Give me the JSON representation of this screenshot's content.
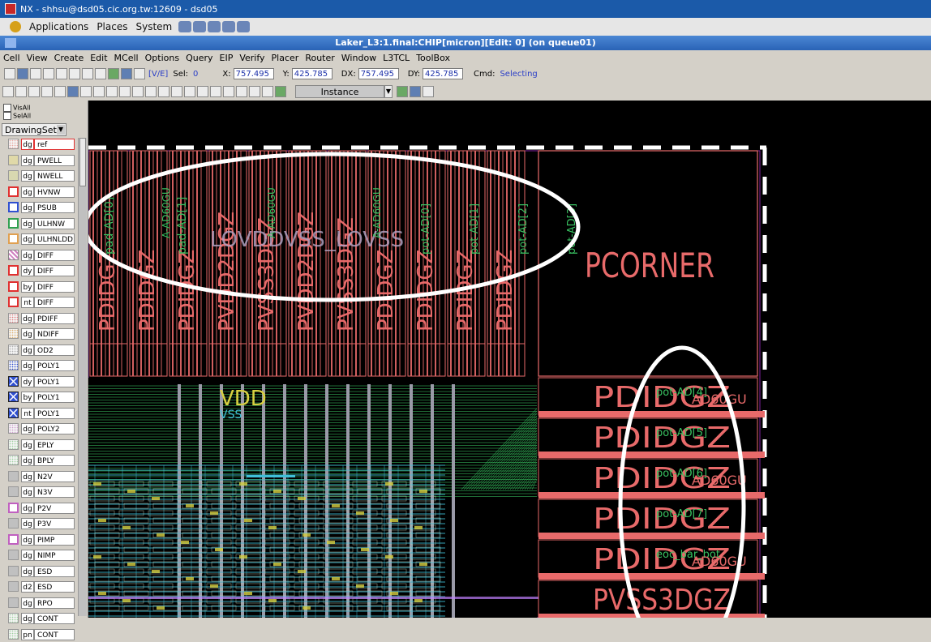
{
  "os": {
    "window_title": "NX - shhsu@dsd05.cic.org.tw:12609 - dsd05",
    "menu": [
      "Applications",
      "Places",
      "System"
    ]
  },
  "app": {
    "title": "Laker_L3:1.final:CHIP[micron][Edit: 0] (on queue01)",
    "menu": [
      "Cell",
      "View",
      "Create",
      "Edit",
      "MCell",
      "Options",
      "Query",
      "EIP",
      "Verify",
      "Placer",
      "Router",
      "Window",
      "L3TCL",
      "ToolBox"
    ],
    "toolbar": {
      "ve_label": "[V/E]",
      "sel_label": "Sel:",
      "sel_value": "0",
      "x_label": "X:",
      "x_value": "757.495",
      "y_label": "Y:",
      "y_value": "425.785",
      "dx_label": "DX:",
      "dx_value": "757.495",
      "dy_label": "DY:",
      "dy_value": "425.785",
      "cmd_label": "Cmd:",
      "cmd_value": "Selecting",
      "instance_select": "Instance"
    }
  },
  "layer_panel": {
    "visall": "VisAll",
    "selall": "SelAll",
    "drawingset": "DrawingSet",
    "layers": [
      {
        "purpose": "dg",
        "name": "ref",
        "color": "#e8a8a0",
        "style": "dots"
      },
      {
        "purpose": "dg",
        "name": "PWELL",
        "color": "#e0d9a8",
        "style": "solid"
      },
      {
        "purpose": "dg",
        "name": "NWELL",
        "color": "#d8d8b0",
        "style": "solid"
      },
      {
        "purpose": "dg",
        "name": "HVNW",
        "color": "#e03030",
        "style": "outline"
      },
      {
        "purpose": "dg",
        "name": "PSUB",
        "color": "#3050d0",
        "style": "outline"
      },
      {
        "purpose": "dg",
        "name": "ULHNW",
        "color": "#30a050",
        "style": "outline"
      },
      {
        "purpose": "dg",
        "name": "ULHNLDD",
        "color": "#e0a050",
        "style": "outline"
      },
      {
        "purpose": "dg",
        "name": "DIFF",
        "color": "#d080c0",
        "style": "hatch"
      },
      {
        "purpose": "dy",
        "name": "DIFF",
        "color": "#e03030",
        "style": "outline"
      },
      {
        "purpose": "by",
        "name": "DIFF",
        "color": "#e03030",
        "style": "outline"
      },
      {
        "purpose": "nt",
        "name": "DIFF",
        "color": "#e03030",
        "style": "outline"
      },
      {
        "purpose": "dg",
        "name": "PDIFF",
        "color": "#e08080",
        "style": "dots"
      },
      {
        "purpose": "dg",
        "name": "NDIFF",
        "color": "#e0b070",
        "style": "dots"
      },
      {
        "purpose": "dg",
        "name": "OD2",
        "color": "#b0b0b0",
        "style": "dots"
      },
      {
        "purpose": "dg",
        "name": "POLY1",
        "color": "#3050d0",
        "style": "dots"
      },
      {
        "purpose": "dy",
        "name": "POLY1",
        "color": "#3050d0",
        "style": "cross"
      },
      {
        "purpose": "by",
        "name": "POLY1",
        "color": "#3050d0",
        "style": "cross"
      },
      {
        "purpose": "nt",
        "name": "POLY1",
        "color": "#3050d0",
        "style": "cross"
      },
      {
        "purpose": "dg",
        "name": "POLY2",
        "color": "#d0a0d0",
        "style": "dots"
      },
      {
        "purpose": "dg",
        "name": "EPLY",
        "color": "#a0d0a0",
        "style": "dots"
      },
      {
        "purpose": "dg",
        "name": "BPLY",
        "color": "#a0d0a0",
        "style": "dots"
      },
      {
        "purpose": "dg",
        "name": "N2V",
        "color": "#c0c0c0",
        "style": "solid"
      },
      {
        "purpose": "dg",
        "name": "N3V",
        "color": "#c0c0c0",
        "style": "solid"
      },
      {
        "purpose": "dg",
        "name": "P2V",
        "color": "#c060c0",
        "style": "outline"
      },
      {
        "purpose": "dg",
        "name": "P3V",
        "color": "#c0c0c0",
        "style": "solid"
      },
      {
        "purpose": "dg",
        "name": "PIMP",
        "color": "#c060c0",
        "style": "outline"
      },
      {
        "purpose": "dg",
        "name": "NIMP",
        "color": "#c0c0c0",
        "style": "solid"
      },
      {
        "purpose": "dg",
        "name": "ESD",
        "color": "#c0c0c0",
        "style": "solid"
      },
      {
        "purpose": "d2",
        "name": "ESD",
        "color": "#c0c0c0",
        "style": "solid"
      },
      {
        "purpose": "dg",
        "name": "RPO",
        "color": "#c0c0c0",
        "style": "solid"
      },
      {
        "purpose": "dg",
        "name": "CONT",
        "color": "#a0d0a0",
        "style": "dots"
      },
      {
        "purpose": "pn",
        "name": "CONT",
        "color": "#a0d0a0",
        "style": "dots"
      }
    ]
  },
  "layout": {
    "corner_label": "PCORNER",
    "vdd_label": "VDD",
    "vss_label": "VSS",
    "top_pad_labels": [
      "PDIDGZ",
      "PDIDGZ",
      "PDIDGZ",
      "PVDD2DGZ",
      "PVSS3DGZ",
      "PVDD2DGZ",
      "PVSS3DGZ",
      "PDIDGZ",
      "PDIDGZ",
      "PDIDGZ",
      "PDIDGZ"
    ],
    "top_overlay_labels": [
      "LOVDDVSS_LOVSS",
      "pot-AD[0]",
      "pot-AD[1]",
      "pot-AD[2]",
      "pot-AD[3]",
      "pad-AD[0]",
      "pad-AD[1]",
      "A-AD60GU",
      "A-AD60GU",
      "A-AD60GU"
    ],
    "right_pad_labels": [
      "PDIDGZ",
      "PDIDGZ",
      "PDIDGZ",
      "PDIDGZ",
      "PDIDGZ",
      "PVSS3DGZ"
    ],
    "right_net_labels": [
      "pot-AD[4]",
      "pot-AD[5]",
      "pot-AD[6]",
      "pot-AD[7]",
      "eoc_bar_bot"
    ],
    "right_model_labels": [
      "AD60GU",
      "AD60GU",
      "AD60GU"
    ]
  },
  "colors": {
    "pad_red": "#e86a6a",
    "metal_green": "#38c060",
    "metal_cyan": "#40c0d8",
    "poly_yellow": "#d8d040",
    "boundary": "#8020a0"
  }
}
